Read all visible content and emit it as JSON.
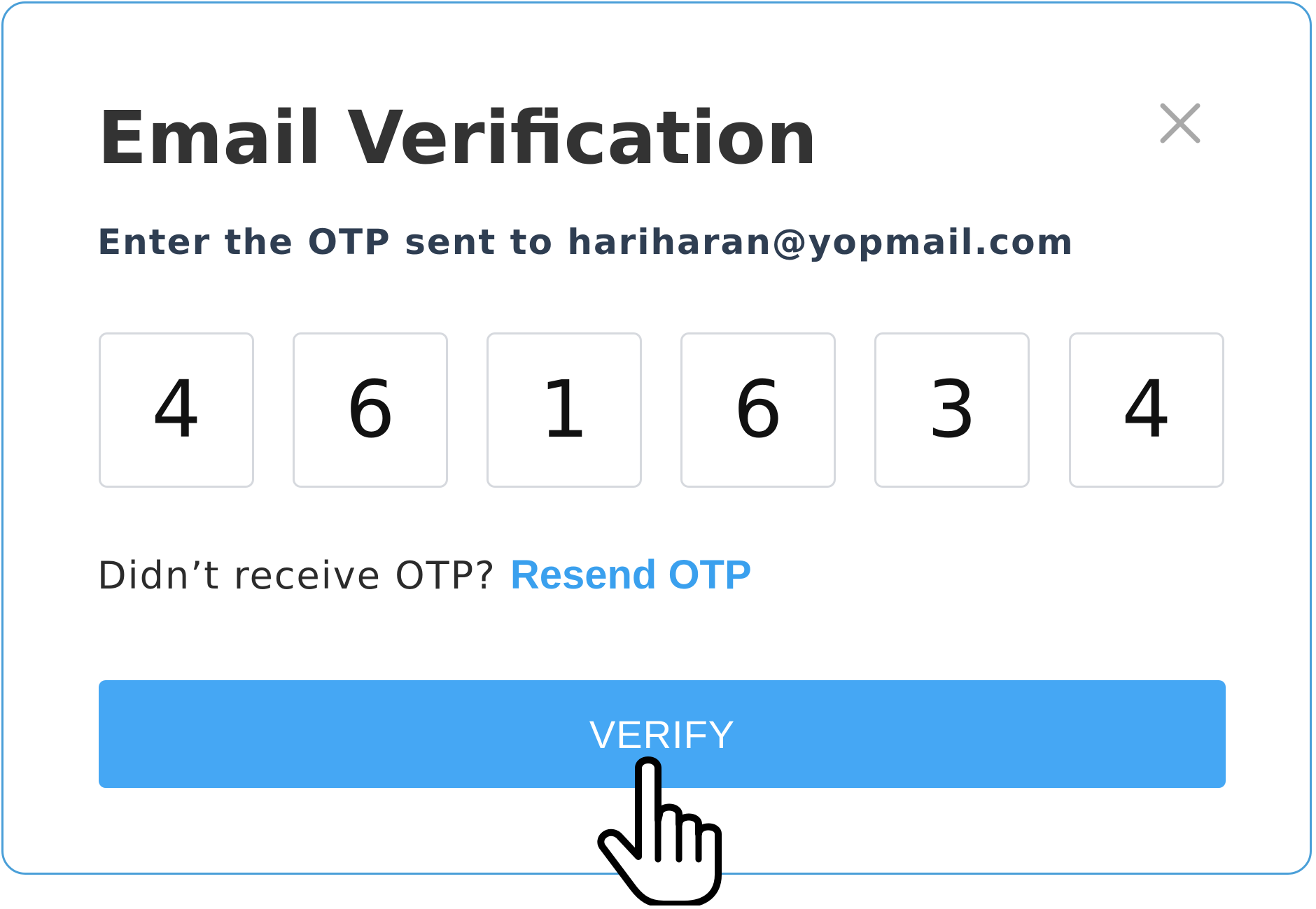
{
  "dialog": {
    "title": "Email Verification",
    "close_icon": "close-icon",
    "subtitle": "Enter the OTP sent to hariharan@yopmail.com",
    "otp_digits": [
      "4",
      "6",
      "1",
      "6",
      "3",
      "4"
    ],
    "resend_prompt": "Didn’t receive OTP?",
    "resend_link": "Resend OTP",
    "verify_label": "VERIFY"
  },
  "cursor": {
    "icon": "hand-pointer-icon"
  },
  "colors": {
    "border": "#4a9fd8",
    "accent": "#45a7f4",
    "link": "#3aa0ee",
    "title": "#333333",
    "subtitle": "#2f3e52"
  }
}
